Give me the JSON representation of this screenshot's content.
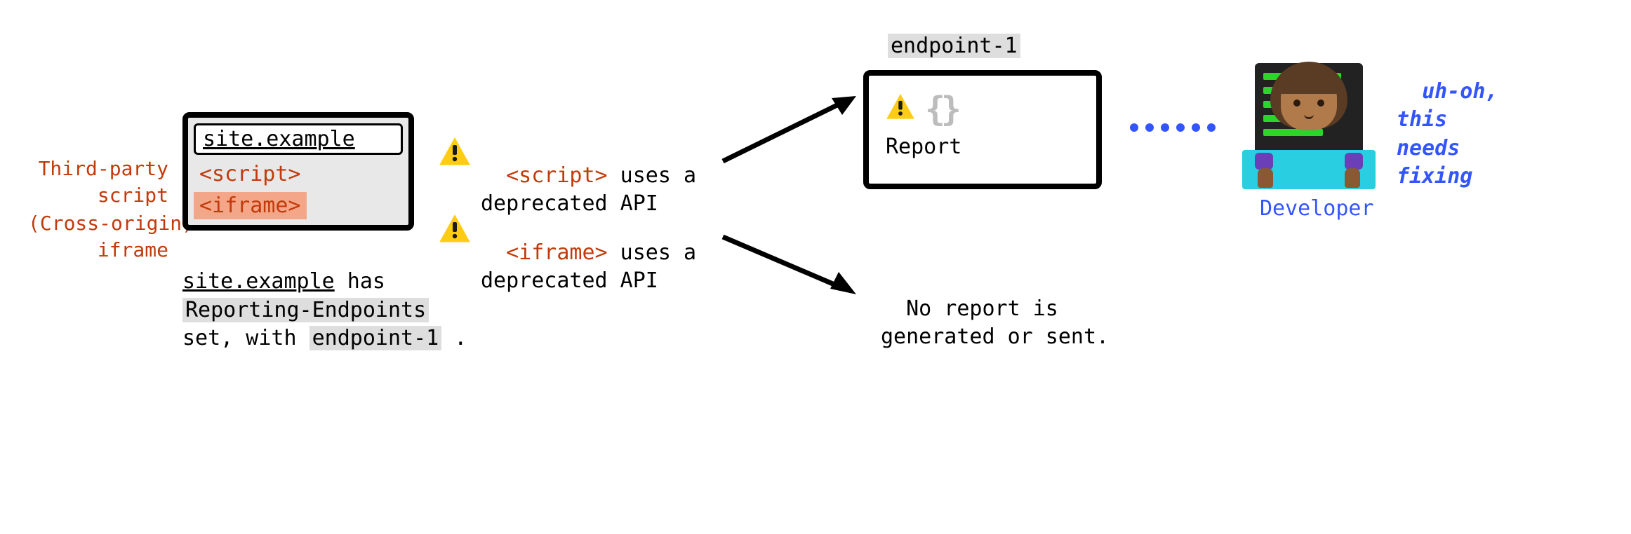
{
  "browser": {
    "url": "site.example",
    "script_tag": "<script>",
    "iframe_tag": "<iframe>"
  },
  "left_labels": {
    "script": "Third-party\nscript",
    "iframe": "(Cross-origin)\niframe"
  },
  "caption": {
    "l1_site": "site.example",
    "l1_rest": " has",
    "l2_header": "Reporting-Endpoints",
    "l3_a": "set, with ",
    "l3_endpoint": "endpoint-1",
    "l3_b": " ."
  },
  "warnings": {
    "script_tag": "<script>",
    "script_rest": " uses a\ndeprecated API",
    "iframe_tag": "<iframe>",
    "iframe_rest": " uses a\ndeprecated API"
  },
  "endpoint": {
    "name": "endpoint-1",
    "braces": "{}",
    "report_label": "Report"
  },
  "no_report": "No report is\ngenerated or sent.",
  "developer": {
    "label": "Developer",
    "thought": "uh-oh,\nthis\nneeds\nfixing"
  }
}
